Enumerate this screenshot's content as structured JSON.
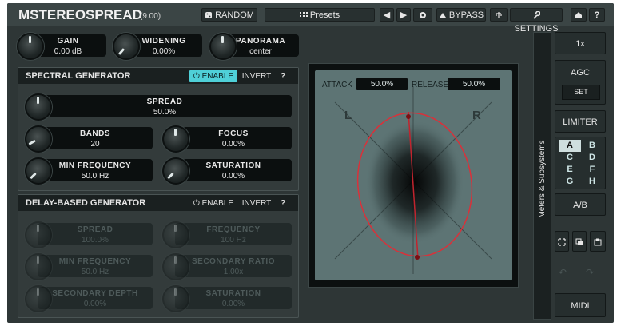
{
  "app": {
    "title": "MSTEREOSPREAD",
    "version": "(9.00)"
  },
  "toolbar": {
    "random_label": "RANDOM",
    "presets_label": "Presets",
    "bypass_label": "BYPASS",
    "settings_label": "SETTINGS",
    "help_label": "?"
  },
  "knobs": {
    "gain": {
      "label": "GAIN",
      "value": "0.00 dB"
    },
    "widening": {
      "label": "WIDENING",
      "value": "0.00%"
    },
    "panorama": {
      "label": "PANORAMA",
      "value": "center"
    }
  },
  "spectral": {
    "title": "SPECTRAL GENERATOR",
    "enable_label": "ENABLE",
    "invert_label": "INVERT",
    "help_label": "?",
    "spread": {
      "label": "SPREAD",
      "value": "50.0%"
    },
    "bands": {
      "label": "BANDS",
      "value": "20"
    },
    "focus": {
      "label": "FOCUS",
      "value": "0.00%"
    },
    "min_frequency": {
      "label": "MIN FREQUENCY",
      "value": "50.0 Hz"
    },
    "saturation": {
      "label": "SATURATION",
      "value": "0.00%"
    }
  },
  "delay": {
    "title": "DELAY-BASED GENERATOR",
    "enable_label": "ENABLE",
    "invert_label": "INVERT",
    "help_label": "?",
    "spread": {
      "label": "SPREAD",
      "value": "100.0%"
    },
    "frequency": {
      "label": "FREQUENCY",
      "value": "100 Hz"
    },
    "min_frequency": {
      "label": "MIN FREQUENCY",
      "value": "50.0 Hz"
    },
    "secondary_ratio": {
      "label": "SECONDARY RATIO",
      "value": "1.00x"
    },
    "secondary_depth": {
      "label": "SECONDARY DEPTH",
      "value": "0.00%"
    },
    "saturation": {
      "label": "SATURATION",
      "value": "0.00%"
    }
  },
  "scope": {
    "attack_label": "ATTACK",
    "attack_value": "50.0%",
    "release_label": "RELEASE",
    "release_value": "50.0%",
    "left_label": "L",
    "right_label": "R"
  },
  "side": {
    "meters_label": "Meters & Subsystems",
    "zoom_label": "1x",
    "agc_label": "AGC",
    "set_label": "SET",
    "limiter_label": "LIMITER",
    "ab_grid": [
      "A",
      "B",
      "C",
      "D",
      "E",
      "F",
      "G",
      "H"
    ],
    "ab_selected": "A",
    "ab_label": "A/B",
    "midi_label": "MIDI"
  },
  "colors": {
    "accent": "#4fd0d8",
    "ellipse": "#d9313a",
    "background": "#2e3636"
  }
}
